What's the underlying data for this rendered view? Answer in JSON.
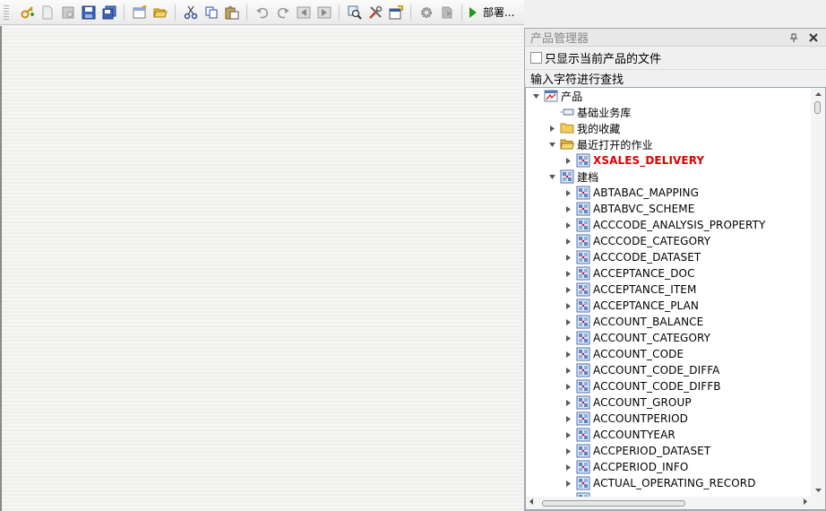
{
  "toolbar": {
    "buttons": [
      {
        "name": "new-key-icon"
      },
      {
        "name": "new-document-icon"
      },
      {
        "name": "disk-gray-icon"
      },
      {
        "name": "save-icon"
      },
      {
        "name": "save-all-icon"
      },
      {
        "sep": true
      },
      {
        "name": "new-window-icon"
      },
      {
        "name": "open-folder-icon"
      },
      {
        "sep": true
      },
      {
        "name": "cut-icon"
      },
      {
        "name": "copy-icon"
      },
      {
        "name": "paste-icon"
      },
      {
        "sep": true
      },
      {
        "name": "undo-icon"
      },
      {
        "name": "redo-icon"
      },
      {
        "name": "step-back-icon"
      },
      {
        "name": "step-forward-icon"
      },
      {
        "sep": true
      },
      {
        "name": "find-icon"
      },
      {
        "name": "tools-icon"
      },
      {
        "name": "properties-icon"
      },
      {
        "sep": true
      },
      {
        "name": "gear-icon"
      },
      {
        "name": "deploy-gray-icon"
      },
      {
        "sep": true
      }
    ],
    "deploy_label": "部署..."
  },
  "panel": {
    "title": "产品管理器",
    "pin_icon": "pin-icon",
    "close_icon": "close-icon",
    "only_current_label": "只显示当前产品的文件",
    "only_current_checked": false,
    "search_label": "输入字符进行查找"
  },
  "tree": [
    {
      "label": "产品",
      "level": 0,
      "expander": "expanded",
      "icon": "product-icon"
    },
    {
      "label": "基础业务库",
      "level": 1,
      "expander": "none",
      "icon": "library-icon"
    },
    {
      "label": "我的收藏",
      "level": 1,
      "expander": "collapsed",
      "icon": "folder-icon"
    },
    {
      "label": "最近打开的作业",
      "level": 1,
      "expander": "expanded",
      "icon": "folder-open-icon"
    },
    {
      "label": "XSALES_DELIVERY",
      "level": 2,
      "expander": "collapsed",
      "icon": "table-icon",
      "highlight": true
    },
    {
      "label": "建档",
      "level": 1,
      "expander": "expanded",
      "icon": "table-icon"
    },
    {
      "label": "ABTABAC_MAPPING",
      "level": 2,
      "expander": "collapsed",
      "icon": "table-icon"
    },
    {
      "label": "ABTABVC_SCHEME",
      "level": 2,
      "expander": "collapsed",
      "icon": "table-icon"
    },
    {
      "label": "ACCCODE_ANALYSIS_PROPERTY",
      "level": 2,
      "expander": "collapsed",
      "icon": "table-icon"
    },
    {
      "label": "ACCCODE_CATEGORY",
      "level": 2,
      "expander": "collapsed",
      "icon": "table-icon"
    },
    {
      "label": "ACCCODE_DATASET",
      "level": 2,
      "expander": "collapsed",
      "icon": "table-icon"
    },
    {
      "label": "ACCEPTANCE_DOC",
      "level": 2,
      "expander": "collapsed",
      "icon": "table-icon"
    },
    {
      "label": "ACCEPTANCE_ITEM",
      "level": 2,
      "expander": "collapsed",
      "icon": "table-icon"
    },
    {
      "label": "ACCEPTANCE_PLAN",
      "level": 2,
      "expander": "collapsed",
      "icon": "table-icon"
    },
    {
      "label": "ACCOUNT_BALANCE",
      "level": 2,
      "expander": "collapsed",
      "icon": "table-icon"
    },
    {
      "label": "ACCOUNT_CATEGORY",
      "level": 2,
      "expander": "collapsed",
      "icon": "table-icon"
    },
    {
      "label": "ACCOUNT_CODE",
      "level": 2,
      "expander": "collapsed",
      "icon": "table-icon"
    },
    {
      "label": "ACCOUNT_CODE_DIFFA",
      "level": 2,
      "expander": "collapsed",
      "icon": "table-icon"
    },
    {
      "label": "ACCOUNT_CODE_DIFFB",
      "level": 2,
      "expander": "collapsed",
      "icon": "table-icon"
    },
    {
      "label": "ACCOUNT_GROUP",
      "level": 2,
      "expander": "collapsed",
      "icon": "table-icon"
    },
    {
      "label": "ACCOUNTPERIOD",
      "level": 2,
      "expander": "collapsed",
      "icon": "table-icon"
    },
    {
      "label": "ACCOUNTYEAR",
      "level": 2,
      "expander": "collapsed",
      "icon": "table-icon"
    },
    {
      "label": "ACCPERIOD_DATASET",
      "level": 2,
      "expander": "collapsed",
      "icon": "table-icon"
    },
    {
      "label": "ACCPERIOD_INFO",
      "level": 2,
      "expander": "collapsed",
      "icon": "table-icon"
    },
    {
      "label": "ACTUAL_OPERATING_RECORD",
      "level": 2,
      "expander": "collapsed",
      "icon": "table-icon"
    },
    {
      "label": "",
      "level": 2,
      "expander": "none",
      "icon": "table-icon"
    }
  ],
  "colors": {
    "highlight": "#e00000",
    "tree_line": "#808080"
  }
}
